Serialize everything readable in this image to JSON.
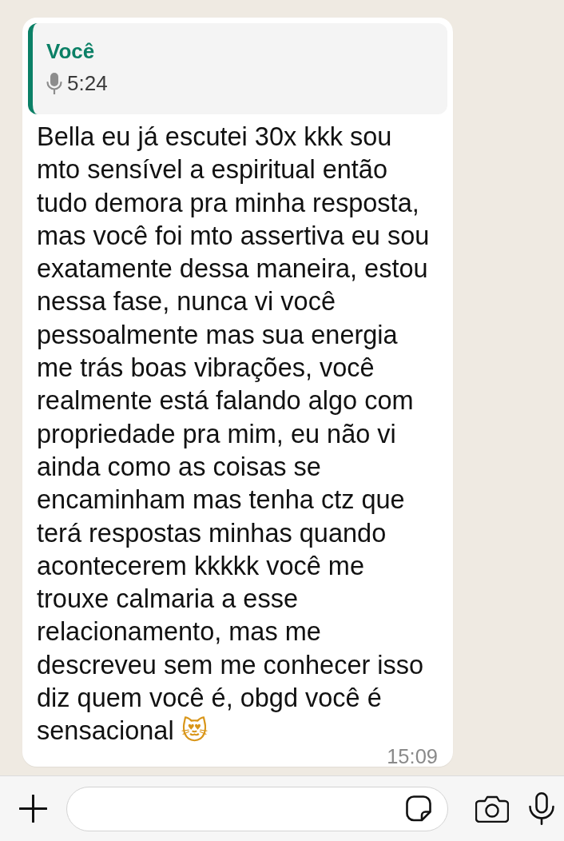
{
  "quoted_message": {
    "sender": "Você",
    "duration": "5:24"
  },
  "message": {
    "text": "Bella eu já escutei 30x kkk sou mto sensível a espiritual então tudo demora pra minha resposta, mas você foi mto assertiva eu sou exatamente dessa maneira, estou nessa fase, nunca vi você pessoalmente mas sua energia me trás boas vibrações, você realmente está falando algo com propriedade pra mim, eu não vi ainda como as coisas se encaminham mas tenha ctz que terá respostas minhas quando acontecerem kkkkk você me trouxe calmaria a esse relacionamento, mas me descreveu sem me conhecer isso diz quem você é, obgd você é sensacional 😻",
    "time": "15:09"
  }
}
